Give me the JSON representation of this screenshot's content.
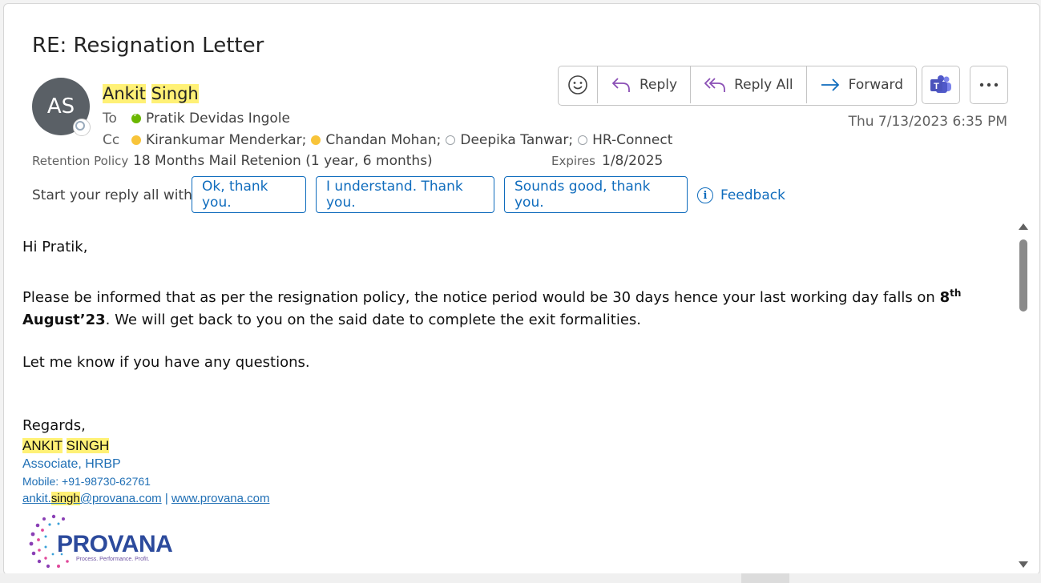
{
  "email": {
    "subject": "RE: Resignation Letter",
    "avatar_initials": "AS",
    "sender_first": "Ankit",
    "sender_last": "Singh",
    "to_label": "To",
    "to": "Pratik Devidas Ingole",
    "cc_label": "Cc",
    "cc": [
      {
        "name": "Kirankumar Menderkar",
        "status": "away",
        "sep": ";"
      },
      {
        "name": "Chandan Mohan",
        "status": "away",
        "sep": ";"
      },
      {
        "name": "Deepika Tanwar",
        "status": "unknown",
        "sep": ";"
      },
      {
        "name": "HR-Connect",
        "status": "unknown",
        "sep": ""
      }
    ],
    "retention_label": "Retention Policy",
    "retention_value": "18 Months Mail Retenion (1 year, 6 months)",
    "expires_label": "Expires",
    "expires_value": "1/8/2025",
    "date": "Thu 7/13/2023 6:35 PM"
  },
  "toolbar": {
    "reply": "Reply",
    "reply_all": "Reply All",
    "forward": "Forward"
  },
  "suggestions": {
    "label": "Start your reply all with:",
    "chips": [
      "Ok, thank you.",
      "I understand. Thank you.",
      "Sounds good, thank you."
    ],
    "feedback": "Feedback"
  },
  "body": {
    "greeting": "Hi Pratik,",
    "para1_a": "Please be informed that as per the resignation policy, the notice period would be 30 days hence your last working day falls on ",
    "para1_bold_a": "8",
    "para1_sup": "th",
    "para1_bold_b": "August’23",
    "para1_b": ". We will get back to you on the said date to complete the exit formalities.",
    "para2": "Let me know if you have any questions.",
    "regards": "Regards,"
  },
  "signature": {
    "name_a": "ANKIT",
    "name_b": "SINGH",
    "title": "Associate, HRBP",
    "mobile": "Mobile: +91-98730-62761",
    "email_a": "ankit.",
    "email_b": "singh",
    "email_c": "@provana.com",
    "divider": "|",
    "website": "www.provana.com",
    "logo_text": "PROVANA",
    "logo_tagline": "Process. Performance. Profit."
  },
  "colors": {
    "accent": "#0f6cbd",
    "highlight": "#fff176",
    "available": "#6bb700",
    "away": "#f8c43a"
  }
}
